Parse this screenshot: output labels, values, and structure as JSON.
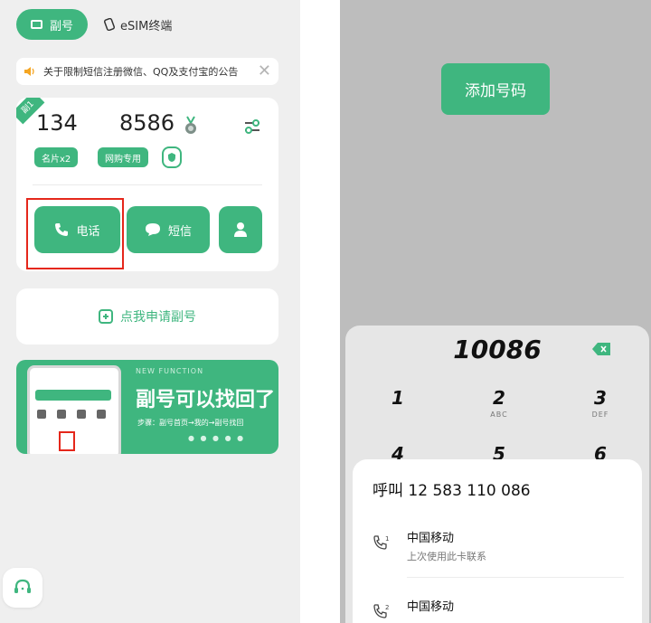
{
  "left": {
    "tabs": {
      "active_label": "副号",
      "esim_label": "eSIM终端"
    },
    "notice": {
      "text": "关于限制短信注册微信、QQ及支付宝的公告",
      "close": "✕"
    },
    "number_card": {
      "corner_badge": "副1",
      "number_part_a": "134",
      "number_part_b": "8586",
      "tag_cards": "名片x2",
      "tag_shopping": "网购专用",
      "call_label": "电话",
      "sms_label": "短信"
    },
    "apply_label": "点我申请副号",
    "banner": {
      "top_text": "NEW FUNCTION",
      "title": "副号可以找回了",
      "subtitle": "步骤：副号首页→我的→副号找回",
      "dots": "● ● ● ● ●"
    }
  },
  "right": {
    "add_number_label": "添加号码",
    "dialer": {
      "display": "10086",
      "keys": [
        {
          "digit": "1",
          "letters": ""
        },
        {
          "digit": "2",
          "letters": "ABC"
        },
        {
          "digit": "3",
          "letters": "DEF"
        },
        {
          "digit": "4",
          "letters": ""
        },
        {
          "digit": "5",
          "letters": ""
        },
        {
          "digit": "6",
          "letters": ""
        }
      ]
    },
    "call_sheet": {
      "title": "呼叫 12 583 110 086",
      "options": [
        {
          "sim": "1",
          "carrier": "中国移动",
          "note": "上次使用此卡联系"
        },
        {
          "sim": "2",
          "carrier": "中国移动",
          "note": ""
        }
      ]
    }
  },
  "colors": {
    "accent": "#3fb67f",
    "highlight_box": "#e5271b",
    "left_bg": "#efefef",
    "right_bg": "#bdbdbd"
  }
}
